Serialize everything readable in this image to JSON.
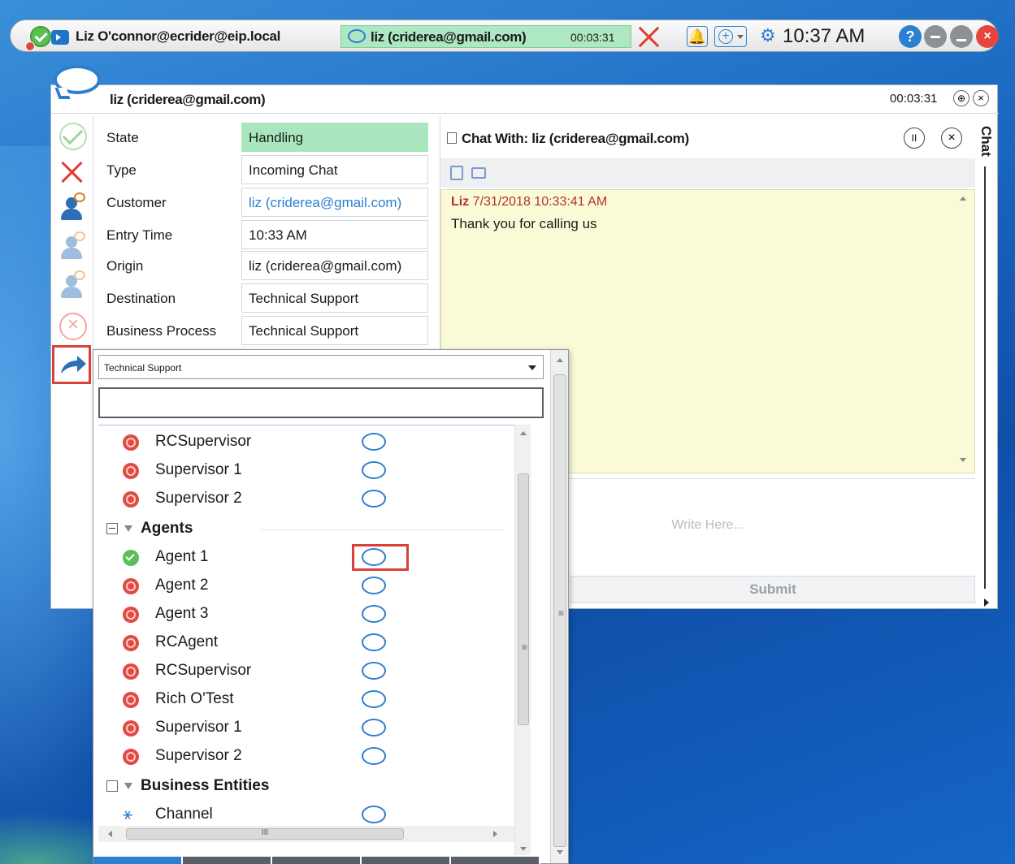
{
  "topbar": {
    "user": "Liz O'connor@ecrider@eip.local",
    "task_name": "liz (criderea@gmail.com)",
    "task_timer": "00:03:31",
    "clock": "10:37 AM",
    "help_glyph": "?",
    "close_glyph": "×",
    "bell_glyph": "🔔",
    "plus_glyph": "+",
    "gear_glyph": "⚙"
  },
  "window": {
    "title": "liz (criderea@gmail.com)",
    "timer": "00:03:31",
    "pin_glyph": "⊕",
    "close_glyph": "×"
  },
  "details": [
    {
      "label": "State",
      "value": "Handling"
    },
    {
      "label": "Type",
      "value": "Incoming Chat"
    },
    {
      "label": "Customer",
      "value": "liz (criderea@gmail.com)"
    },
    {
      "label": "Entry Time",
      "value": "10:33 AM"
    },
    {
      "label": "Origin",
      "value": "liz (criderea@gmail.com)"
    },
    {
      "label": "Destination",
      "value": "Technical Support"
    },
    {
      "label": "Business Process",
      "value": "Technical Support"
    }
  ],
  "chat": {
    "heading": "Chat With: liz (criderea@gmail.com)",
    "pause_glyph": "II",
    "close_glyph": "×",
    "messages": [
      {
        "sender": "Liz",
        "timestamp": "7/31/2018 10:33:41 AM",
        "text": "Thank you for calling us"
      }
    ],
    "input_placeholder": "Write Here...",
    "submit_label": "Submit",
    "side_tab": "Chat"
  },
  "transfer": {
    "destination": "Technical Support",
    "search_value": "",
    "h_thumb_glyph": "III",
    "grip_glyph": "≡",
    "channel_glyph": "⚹",
    "supervisors": [
      "RCSupervisor",
      "Supervisor 1",
      "Supervisor 2"
    ],
    "agents_group": "Agents",
    "agents": [
      {
        "name": "Agent 1",
        "status": "available"
      },
      {
        "name": "Agent 2",
        "status": "busy"
      },
      {
        "name": "Agent 3",
        "status": "busy"
      },
      {
        "name": "RCAgent",
        "status": "busy"
      },
      {
        "name": "RCSupervisor",
        "status": "busy"
      },
      {
        "name": "Rich O'Test",
        "status": "busy"
      },
      {
        "name": "Supervisor 1",
        "status": "busy"
      },
      {
        "name": "Supervisor 2",
        "status": "busy"
      }
    ],
    "business_group": "Business Entities",
    "business_entities": [
      "Channel"
    ]
  },
  "colors": {
    "accent": "#2c7fd1",
    "state_bg": "#a9e6be",
    "busy": "#e34a42",
    "available": "#5cbf55",
    "highlight": "#d9423a",
    "chat_log_bg": "#fbfad6"
  }
}
